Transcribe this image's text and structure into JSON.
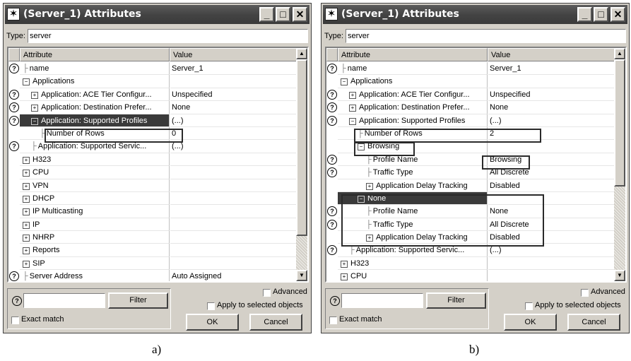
{
  "windows": [
    {
      "title": "(Server_1) Attributes",
      "type_label": "Type:",
      "type_value": "server",
      "col_attribute": "Attribute",
      "col_value": "Value",
      "rows": [
        {
          "name": "name",
          "value": "Server_1",
          "help": true,
          "indent": 0,
          "prefix": "tick"
        },
        {
          "name": "Applications",
          "value": "",
          "help": false,
          "indent": 0,
          "prefix": "minus"
        },
        {
          "name": "Application: ACE Tier Configur...",
          "value": "Unspecified",
          "help": true,
          "indent": 1,
          "prefix": "plus"
        },
        {
          "name": "Application: Destination Prefer...",
          "value": "None",
          "help": true,
          "indent": 1,
          "prefix": "plus"
        },
        {
          "name": "Application: Supported Profiles",
          "value": "(...)",
          "help": true,
          "indent": 1,
          "prefix": "minus",
          "selected": true
        },
        {
          "name": "Number of Rows",
          "value": "0",
          "help": false,
          "indent": 2,
          "prefix": "tick"
        },
        {
          "name": "Application: Supported Servic...",
          "value": "(...)",
          "help": true,
          "indent": 1,
          "prefix": "tick"
        },
        {
          "name": "H323",
          "value": "",
          "help": false,
          "indent": 0,
          "prefix": "plus"
        },
        {
          "name": "CPU",
          "value": "",
          "help": false,
          "indent": 0,
          "prefix": "plus"
        },
        {
          "name": "VPN",
          "value": "",
          "help": false,
          "indent": 0,
          "prefix": "plus"
        },
        {
          "name": "DHCP",
          "value": "",
          "help": false,
          "indent": 0,
          "prefix": "plus"
        },
        {
          "name": "IP Multicasting",
          "value": "",
          "help": false,
          "indent": 0,
          "prefix": "plus"
        },
        {
          "name": "IP",
          "value": "",
          "help": false,
          "indent": 0,
          "prefix": "plus"
        },
        {
          "name": "NHRP",
          "value": "",
          "help": false,
          "indent": 0,
          "prefix": "plus"
        },
        {
          "name": "Reports",
          "value": "",
          "help": false,
          "indent": 0,
          "prefix": "plus"
        },
        {
          "name": "SIP",
          "value": "",
          "help": false,
          "indent": 0,
          "prefix": "plus"
        },
        {
          "name": "Server Address",
          "value": "Auto Assigned",
          "help": true,
          "indent": 0,
          "prefix": "tick"
        }
      ],
      "filter_label": "Filter",
      "exact_match_label": "Exact match",
      "advanced_label": "Advanced",
      "apply_label": "Apply to selected objects",
      "ok_label": "OK",
      "cancel_label": "Cancel",
      "caption": "a)"
    },
    {
      "title": "(Server_1) Attributes",
      "type_label": "Type:",
      "type_value": "server",
      "col_attribute": "Attribute",
      "col_value": "Value",
      "rows": [
        {
          "name": "name",
          "value": "Server_1",
          "help": true,
          "indent": 0,
          "prefix": "tick"
        },
        {
          "name": "Applications",
          "value": "",
          "help": false,
          "indent": 0,
          "prefix": "minus"
        },
        {
          "name": "Application: ACE Tier Configur...",
          "value": "Unspecified",
          "help": true,
          "indent": 1,
          "prefix": "plus"
        },
        {
          "name": "Application: Destination Prefer...",
          "value": "None",
          "help": true,
          "indent": 1,
          "prefix": "plus"
        },
        {
          "name": "Application: Supported Profiles",
          "value": "(...)",
          "help": true,
          "indent": 1,
          "prefix": "minus"
        },
        {
          "name": "Number of Rows",
          "value": "2",
          "help": false,
          "indent": 2,
          "prefix": "tick"
        },
        {
          "name": "Browsing",
          "value": "",
          "help": false,
          "indent": 2,
          "prefix": "minus"
        },
        {
          "name": "Profile Name",
          "value": "Browsing",
          "help": true,
          "indent": 3,
          "prefix": "tick"
        },
        {
          "name": "Traffic Type",
          "value": "All Discrete",
          "help": true,
          "indent": 3,
          "prefix": "tick"
        },
        {
          "name": "Application Delay Tracking",
          "value": "Disabled",
          "help": false,
          "indent": 3,
          "prefix": "plus"
        },
        {
          "name": "None",
          "value": "",
          "help": false,
          "indent": 2,
          "prefix": "minus",
          "selected": true
        },
        {
          "name": "Profile Name",
          "value": "None",
          "help": true,
          "indent": 3,
          "prefix": "tick"
        },
        {
          "name": "Traffic Type",
          "value": "All Discrete",
          "help": true,
          "indent": 3,
          "prefix": "tick"
        },
        {
          "name": "Application Delay Tracking",
          "value": "Disabled",
          "help": false,
          "indent": 3,
          "prefix": "plus"
        },
        {
          "name": "Application: Supported Servic...",
          "value": "(...)",
          "help": true,
          "indent": 1,
          "prefix": "tick"
        },
        {
          "name": "H323",
          "value": "",
          "help": false,
          "indent": 0,
          "prefix": "plus"
        },
        {
          "name": "CPU",
          "value": "",
          "help": false,
          "indent": 0,
          "prefix": "plus"
        }
      ],
      "filter_label": "Filter",
      "exact_match_label": "Exact match",
      "advanced_label": "Advanced",
      "apply_label": "Apply to selected objects",
      "ok_label": "OK",
      "cancel_label": "Cancel",
      "caption": "b)"
    }
  ],
  "icons": {
    "app_icon": "star-icon",
    "help_icon": "question-circle-icon",
    "minimize": "minimize-icon",
    "maximize": "maximize-icon",
    "close": "close-icon"
  },
  "glyphs": {
    "help": "?",
    "plus": "+",
    "minus": "−",
    "tick": "├",
    "app": "✶",
    "min": "_",
    "max": "□",
    "close": "✕",
    "up": "▲",
    "down": "▼"
  }
}
